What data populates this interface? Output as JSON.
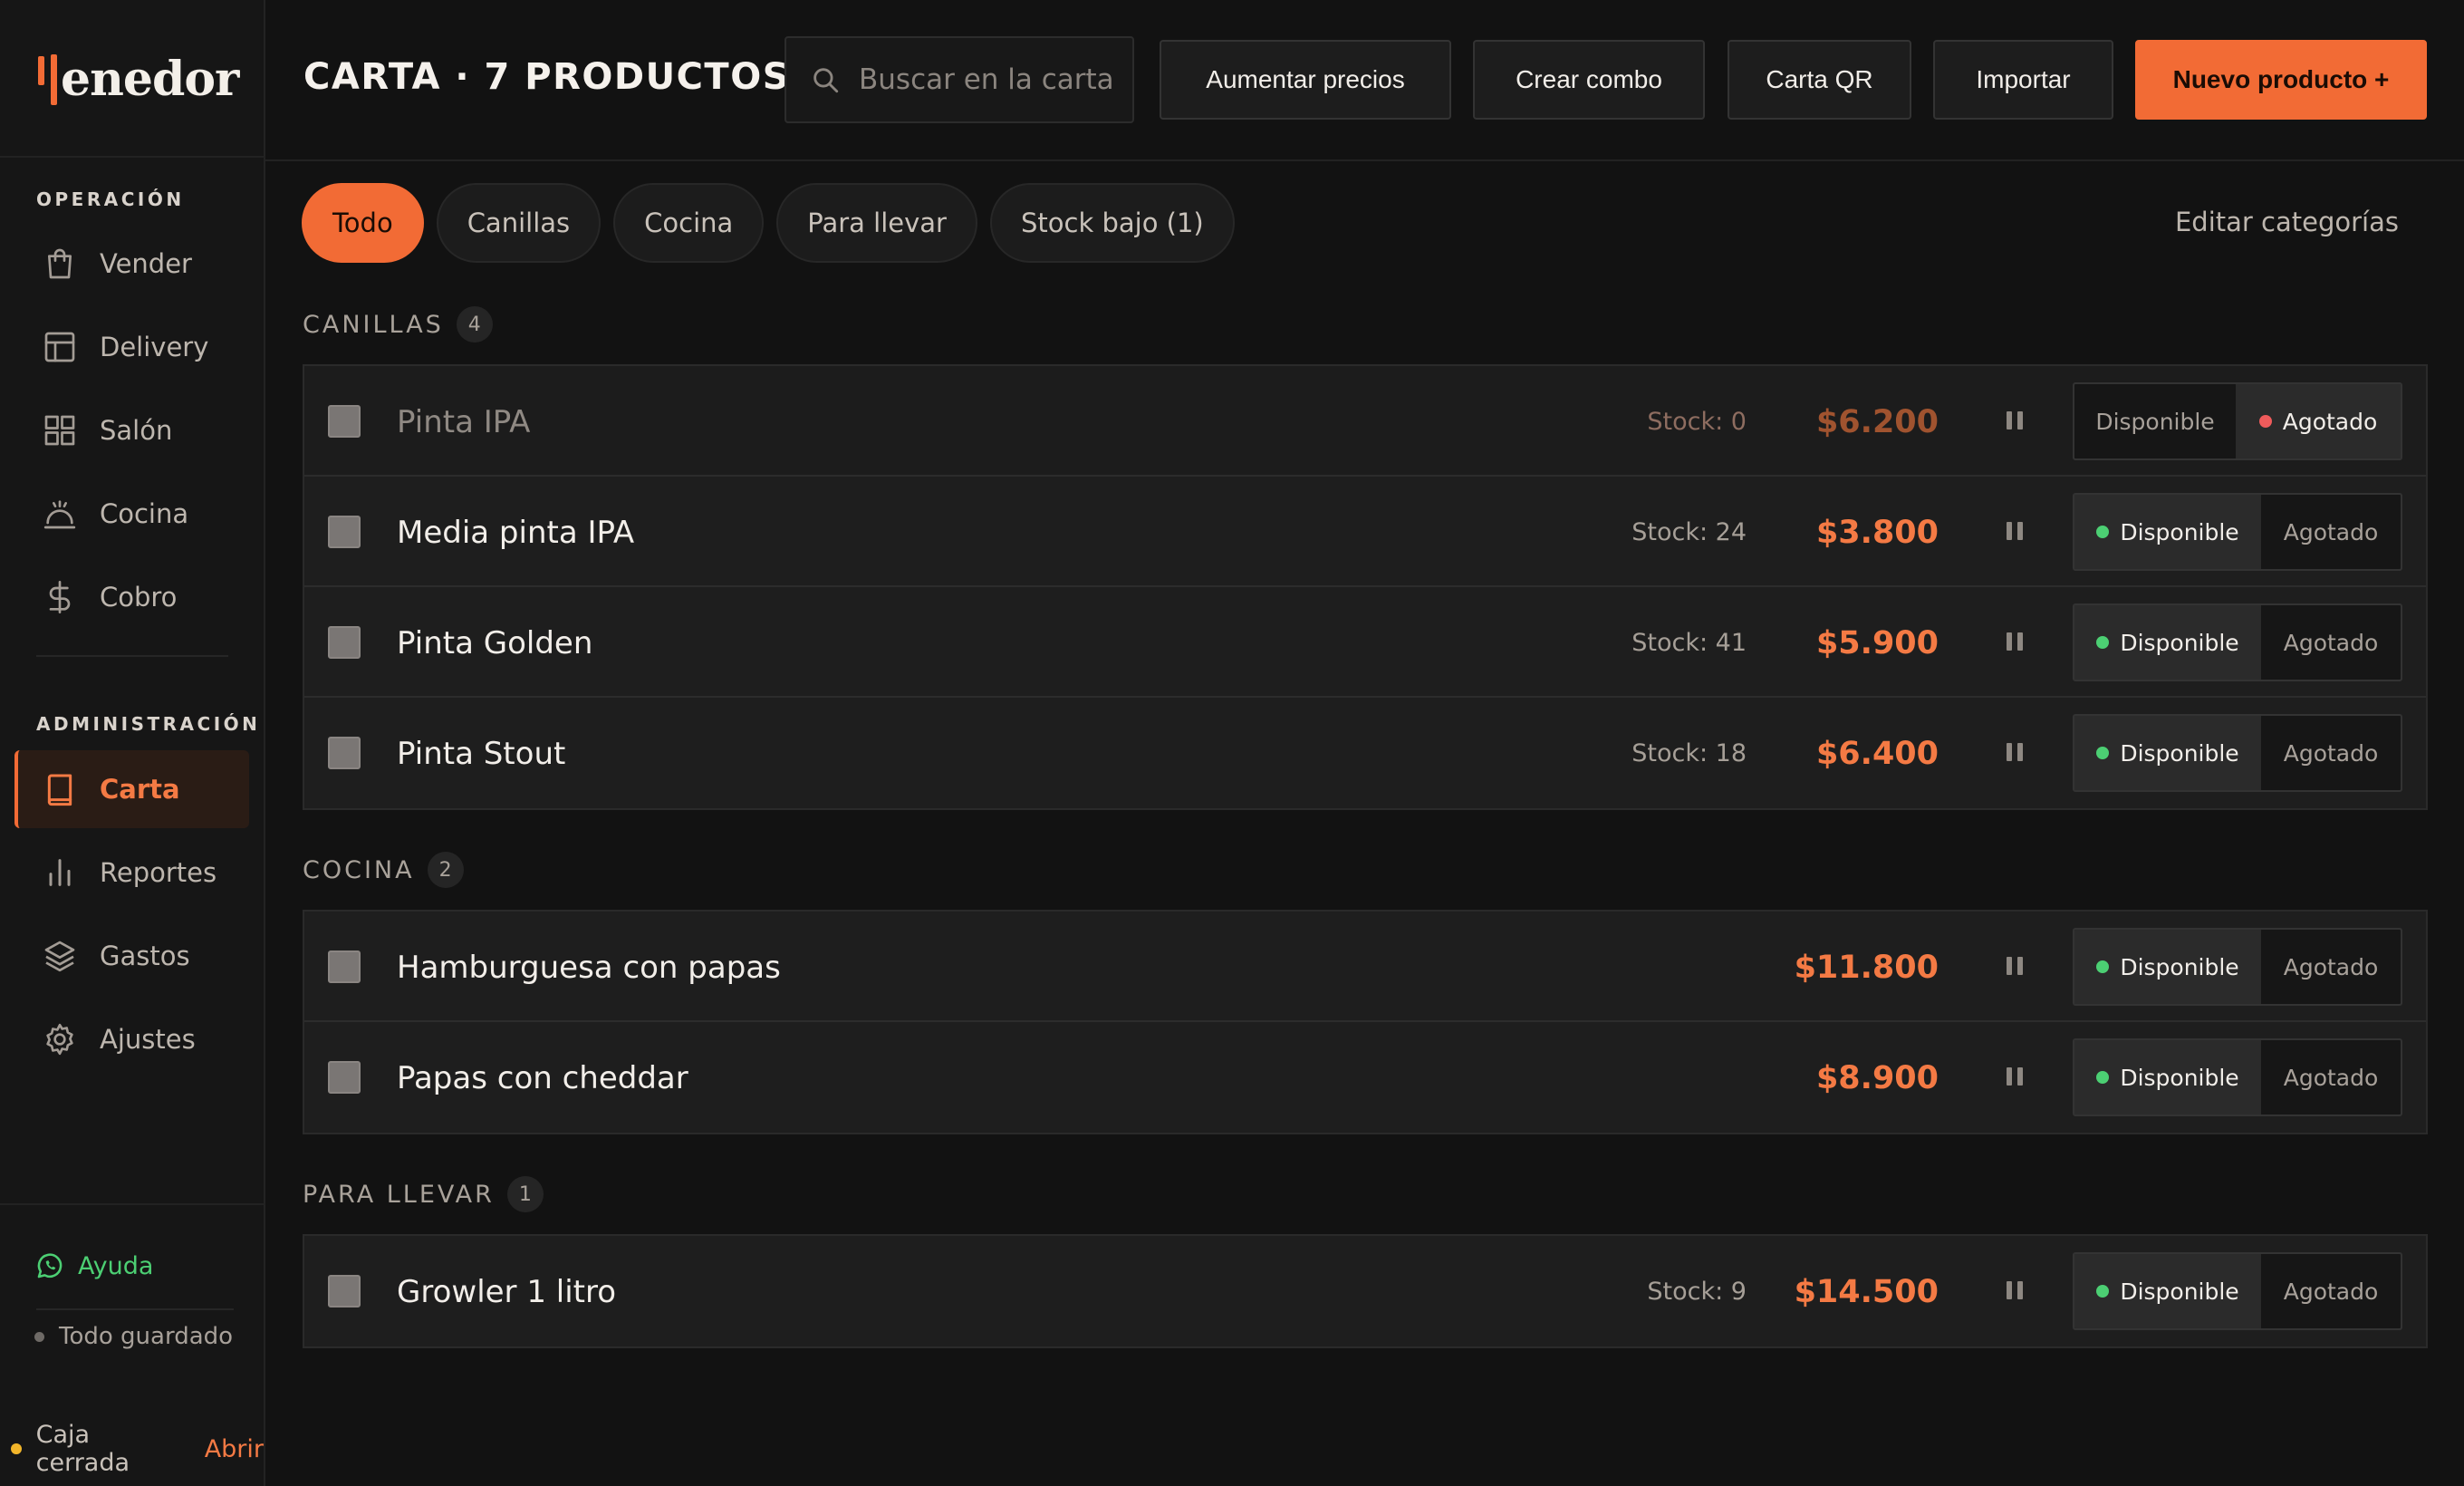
{
  "app": {
    "logo_text": "enedor"
  },
  "colors": {
    "accent": "#f26b35",
    "available": "#4ccf73",
    "soldout": "#ef5b5b",
    "pending": "#f2b52a"
  },
  "sidebar": {
    "operacion_label": "OPERACIÓN",
    "admin_label": "ADMINISTRACIÓN",
    "items": [
      {
        "label": "Vender",
        "icon": "shopping-bag-icon"
      },
      {
        "label": "Delivery",
        "icon": "panel-icon"
      },
      {
        "label": "Salón",
        "icon": "grid-icon"
      },
      {
        "label": "Cocina",
        "icon": "cloche-icon"
      },
      {
        "label": "Cobro",
        "icon": "dollar-icon"
      },
      {
        "label": "Carta",
        "icon": "book-icon",
        "active": true
      },
      {
        "label": "Reportes",
        "icon": "bar-chart-icon"
      },
      {
        "label": "Gastos",
        "icon": "layers-icon"
      },
      {
        "label": "Ajustes",
        "icon": "gear-icon"
      }
    ],
    "help_label": "Ayuda",
    "saved_label": "Todo guardado",
    "caja_label": "Caja cerrada",
    "caja_action": "Abrir"
  },
  "header": {
    "title": "CARTA · 7 PRODUCTOS",
    "search_placeholder": "Buscar en la carta",
    "buttons": {
      "raise_prices": "Aumentar precios",
      "create_combo": "Crear combo",
      "qr_menu": "Carta QR",
      "import": "Importar",
      "new_product": "Nuevo producto +"
    }
  },
  "filters": {
    "tabs": [
      "Todo",
      "Canillas",
      "Cocina",
      "Para llevar",
      "Stock bajo (1)"
    ],
    "active": "Todo",
    "edit_categories": "Editar categorías"
  },
  "toggle_labels": {
    "available": "Disponible",
    "soldout": "Agotado"
  },
  "groups": [
    {
      "title": "CANILLAS",
      "count": "4",
      "products": [
        {
          "name": "Pinta IPA",
          "stock": "Stock: 0",
          "price": "$6.200",
          "status": "soldout"
        },
        {
          "name": "Media pinta IPA",
          "stock": "Stock: 24",
          "price": "$3.800",
          "status": "available"
        },
        {
          "name": "Pinta Golden",
          "stock": "Stock: 41",
          "price": "$5.900",
          "status": "available"
        },
        {
          "name": "Pinta Stout",
          "stock": "Stock: 18",
          "price": "$6.400",
          "status": "available"
        }
      ]
    },
    {
      "title": "COCINA",
      "count": "2",
      "products": [
        {
          "name": "Hamburguesa con papas",
          "stock": "",
          "price": "$11.800",
          "status": "available"
        },
        {
          "name": "Papas con cheddar",
          "stock": "",
          "price": "$8.900",
          "status": "available"
        }
      ]
    },
    {
      "title": "PARA LLEVAR",
      "count": "1",
      "products": [
        {
          "name": "Growler 1 litro",
          "stock": "Stock: 9",
          "price": "$14.500",
          "status": "available"
        }
      ]
    }
  ]
}
